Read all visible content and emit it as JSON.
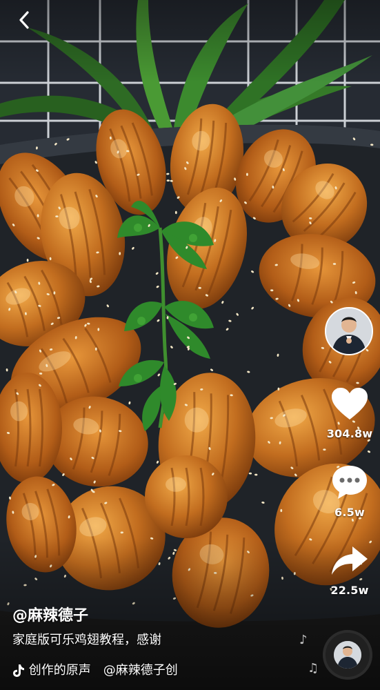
{
  "video": {
    "scene": "cola-chicken-wings-plate",
    "colors": {
      "plate": "#1e2226",
      "glaze": "#b4631a",
      "wing_light": "#e0953a",
      "cilantro": "#2f8a2b",
      "tiles": "#2a2f36"
    }
  },
  "nav": {
    "back_icon": "chevron-left-icon"
  },
  "rail": {
    "avatar_icon": "creator-avatar",
    "like": {
      "icon": "heart-icon",
      "count": "304.8w"
    },
    "comment": {
      "icon": "comment-bubble-icon",
      "count": "6.5w"
    },
    "share": {
      "icon": "share-arrow-icon",
      "count": "22.5w"
    }
  },
  "caption": {
    "author": "@麻辣德子",
    "description": "家庭版可乐鸡翅教程，感谢"
  },
  "music": {
    "icon": "tiktok-note-icon",
    "text": "创作的原声　@麻辣德子创",
    "disc_icon": "music-disc-icon"
  }
}
